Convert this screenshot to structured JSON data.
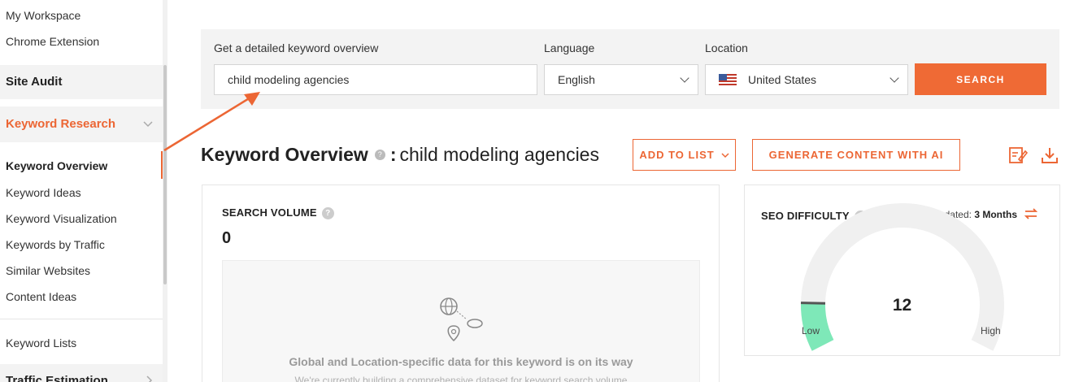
{
  "sidebar": {
    "top_items": [
      "My Workspace",
      "Chrome Extension"
    ],
    "site_audit": "Site Audit",
    "keyword_research": "Keyword Research",
    "sub_items": [
      "Keyword Overview",
      "Keyword Ideas",
      "Keyword Visualization",
      "Keywords by Traffic",
      "Similar Websites",
      "Content Ideas"
    ],
    "keyword_lists": "Keyword Lists",
    "traffic_estimation": "Traffic Estimation"
  },
  "search": {
    "keyword_label": "Get a detailed keyword overview",
    "keyword_value": "child modeling agencies",
    "language_label": "Language",
    "language_value": "English",
    "location_label": "Location",
    "location_value": "United States",
    "button": "SEARCH"
  },
  "overview": {
    "title": "Keyword Overview",
    "separator": ":",
    "keyword": "child modeling agencies",
    "add_to_list": "ADD TO LIST",
    "generate": "GENERATE CONTENT WITH AI"
  },
  "search_volume": {
    "title": "SEARCH VOLUME",
    "value": "0",
    "empty_title": "Global and Location-specific data for this keyword is on its way",
    "empty_sub": "We're currently building a comprehensive dataset for keyword search volume"
  },
  "seo_difficulty": {
    "title": "SEO DIFFICULTY",
    "last_updated_label": "Last Updated:",
    "last_updated_value": "3 Months",
    "value": "12",
    "level": 0.12,
    "low": "Low",
    "high": "High"
  },
  "colors": {
    "accent": "#ec6634",
    "gauge_fill": "#7ee8b8",
    "gauge_track": "#f0f0f0"
  }
}
